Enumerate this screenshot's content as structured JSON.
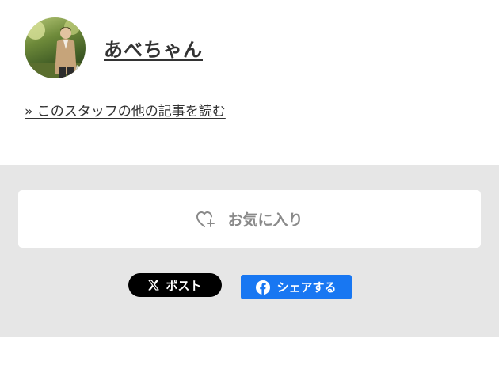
{
  "author": {
    "name": "あべちゃん",
    "avatar_icon": "person-photo-avatar"
  },
  "more_articles_link": "» このスタッフの他の記事を読む",
  "favorite": {
    "label": "お気に入り",
    "icon": "heart-plus-icon"
  },
  "share": {
    "x_label": "ポスト",
    "x_icon": "x-logo-icon",
    "fb_label": "シェアする",
    "fb_icon": "facebook-logo-icon"
  },
  "colors": {
    "band_background": "#e6e6e6",
    "facebook_blue": "#1877f2",
    "x_black": "#000000",
    "muted_text": "#8a8a8a"
  }
}
